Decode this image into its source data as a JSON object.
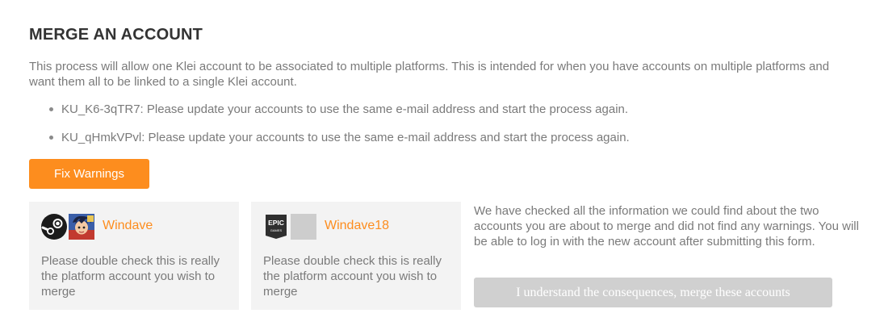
{
  "page": {
    "title": "MERGE AN ACCOUNT",
    "intro": "This process will allow one Klei account to be associated to multiple platforms. This is intended for when you have accounts on multiple platforms and want them all to be linked to a single Klei account."
  },
  "warnings": [
    "KU_K6-3qTR7: Please update your accounts to use the same e-mail address and start the process again.",
    "KU_qHmkVPvl: Please update your accounts to use the same e-mail address and start the process again."
  ],
  "fix_button": {
    "label": "Fix Warnings",
    "color": "#fd8d1e"
  },
  "accounts": [
    {
      "platform_icon": "steam-icon",
      "avatar_icon": "user-avatar",
      "name": "Windave",
      "note": "Please double check this is really the platform account you wish to merge"
    },
    {
      "platform_icon": "epic-games-icon",
      "avatar_icon": "blank-avatar",
      "name": "Windave18",
      "note": "Please double check this is really the platform account you wish to merge"
    }
  ],
  "summary": {
    "text": "We have checked all the information we could find about the two accounts you are about to merge and did not find any warnings. You will be able to log in with the new account after submitting this form.",
    "merge_button_label": "I understand the consequences, merge these accounts",
    "merge_button_disabled": true
  },
  "colors": {
    "accent": "#fd8d1e",
    "card_bg": "#f3f3f3",
    "disabled_button": "#d0d0d0",
    "body_text": "#7a7a7a",
    "heading_text": "#333333"
  }
}
